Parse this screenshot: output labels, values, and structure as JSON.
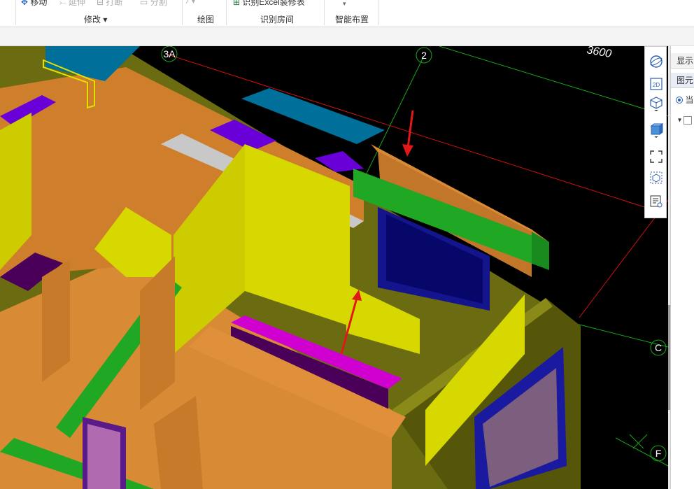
{
  "ribbon": {
    "tools": {
      "move": "移动",
      "extend": "延伸",
      "break": "打断",
      "split": "分割",
      "identify_excel": "识别Excel装修表"
    },
    "groups": {
      "modify": "修改",
      "draw": "绘图",
      "identify_room": "识别房间",
      "smart_layout": "智能布置"
    }
  },
  "viewport": {
    "axis_labels": {
      "a3": "3A",
      "a2": "2",
      "c": "C",
      "f": "F"
    },
    "dimension_text": "3600"
  },
  "view_toolbar": {
    "icons": [
      "orbit-icon",
      "2d-view-icon",
      "3d-view-icon",
      "box-view-icon",
      "fit-extent-icon",
      "element-view-icon",
      "display-settings-icon"
    ],
    "label_2d": "2D"
  },
  "right_panel": {
    "tab_display": "显示",
    "tab_element": "图元",
    "radio_label": "当"
  },
  "colors": {
    "orange_wall": "#d98a34",
    "yellow_wall": "#d7d800",
    "purple_column": "#6a00d8",
    "green_beam": "#20a825",
    "teal_slab": "#006f99",
    "annotation_arrow": "#e01818"
  }
}
